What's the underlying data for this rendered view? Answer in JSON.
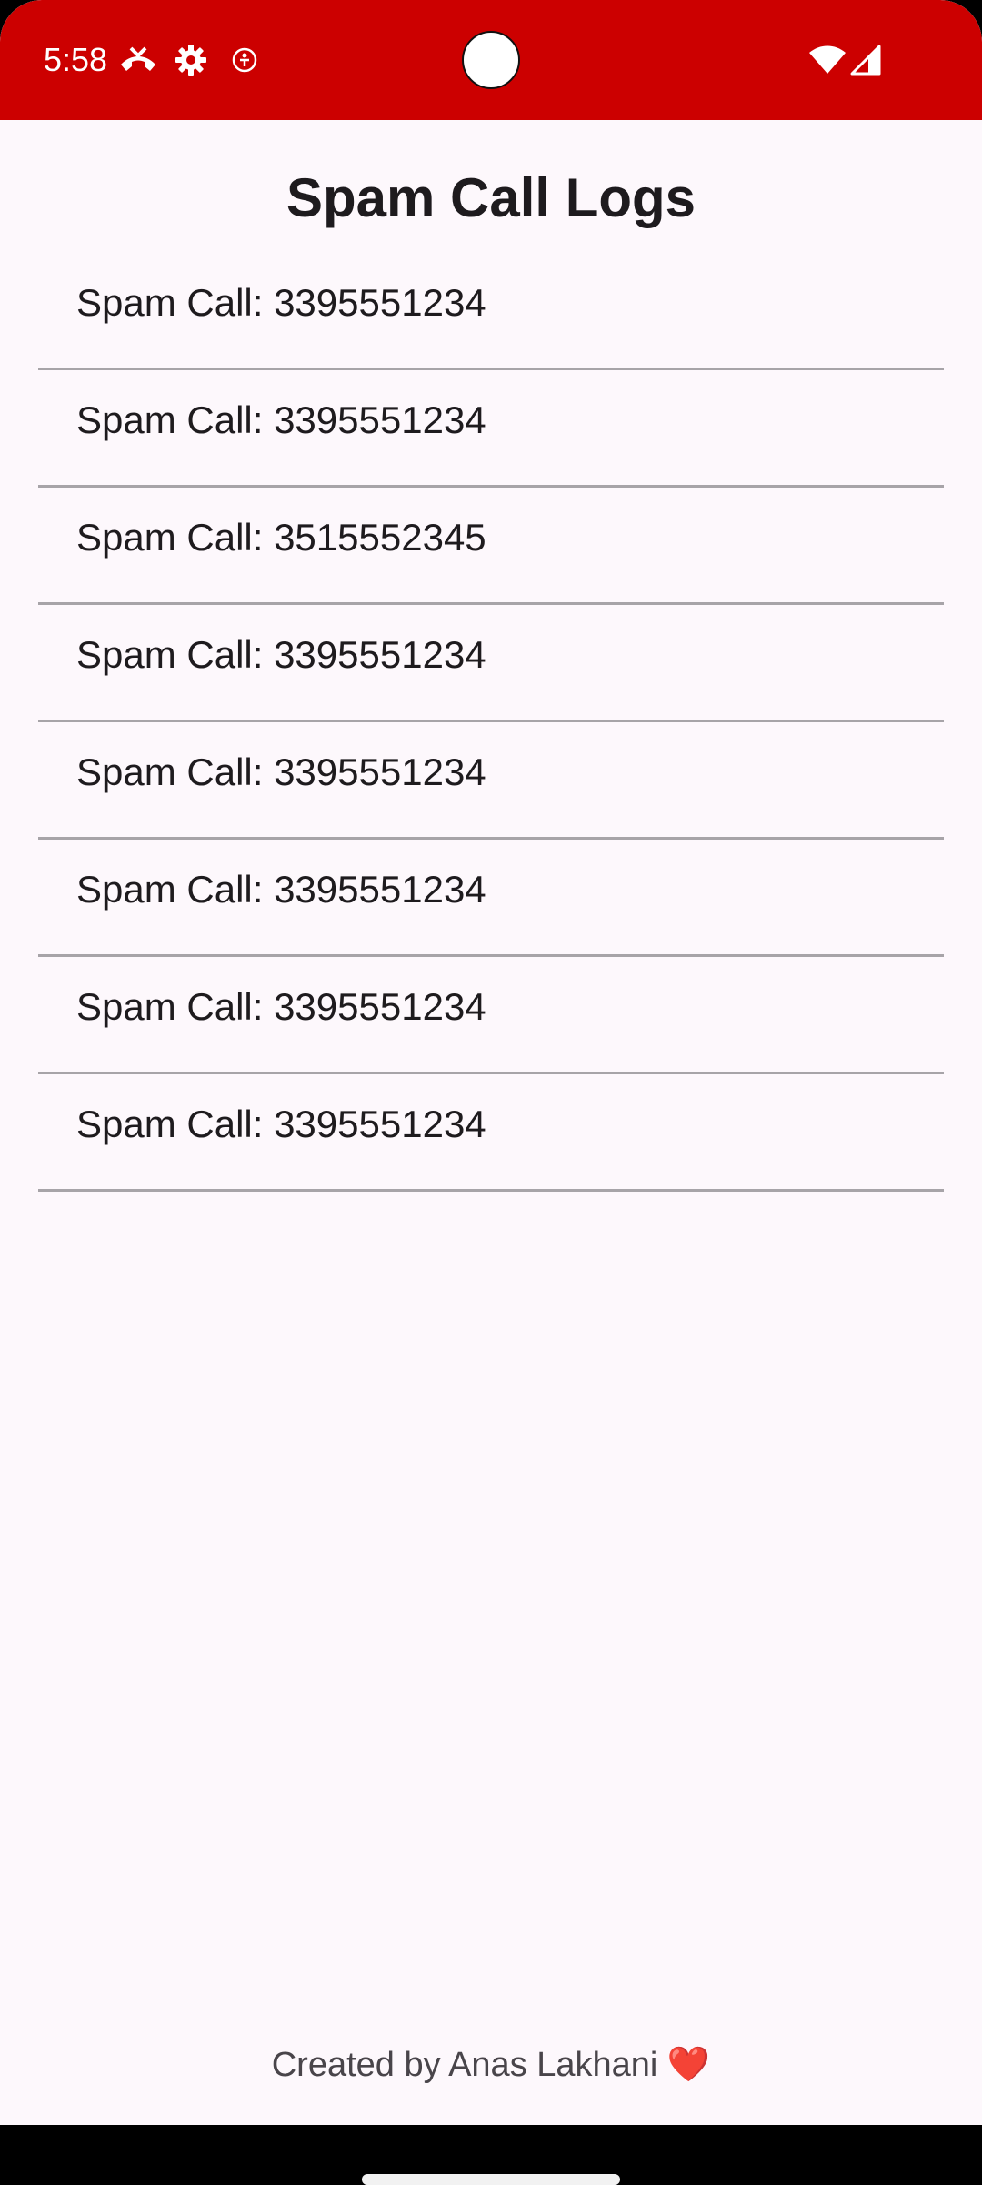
{
  "status_bar": {
    "time": "5:58",
    "icons": [
      "missed-call-icon",
      "gear-icon",
      "accessibility-icon",
      "wifi-icon",
      "cell-signal-icon"
    ],
    "color": "#CC0000"
  },
  "page": {
    "title": "Spam Call Logs"
  },
  "calls": [
    {
      "label": "Spam Call: 3395551234"
    },
    {
      "label": "Spam Call: 3395551234"
    },
    {
      "label": "Spam Call: 3515552345"
    },
    {
      "label": "Spam Call: 3395551234"
    },
    {
      "label": "Spam Call: 3395551234"
    },
    {
      "label": "Spam Call: 3395551234"
    },
    {
      "label": "Spam Call: 3395551234"
    },
    {
      "label": "Spam Call: 3395551234"
    }
  ],
  "footer": {
    "text": "Created by Anas Lakhani",
    "emoji": "❤️"
  }
}
